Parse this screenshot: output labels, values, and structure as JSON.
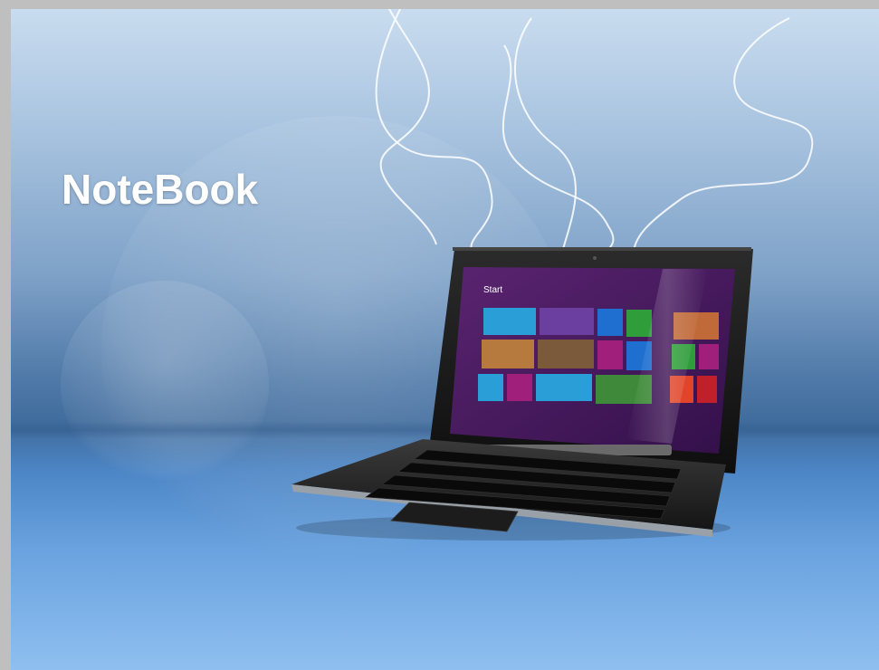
{
  "slide": {
    "title": "NoteBook"
  },
  "laptop": {
    "start_label": "Start",
    "tiles": [
      {
        "name": "mail-tile",
        "color": "#2a9ed6"
      },
      {
        "name": "calendar-tile",
        "color": "#6b3fa0"
      },
      {
        "name": "ie-tile",
        "color": "#1e6fd0"
      },
      {
        "name": "store-tile",
        "color": "#2f9d3a"
      },
      {
        "name": "people-tile",
        "color": "#b67a3e"
      },
      {
        "name": "photos-tile",
        "color": "#5a4a3a"
      },
      {
        "name": "music-tile",
        "color": "#a01f7a"
      },
      {
        "name": "skydrive-tile",
        "color": "#1e6fd0"
      },
      {
        "name": "weather-tile",
        "color": "#2a9ed6"
      },
      {
        "name": "messaging-tile",
        "color": "#a01f7a"
      },
      {
        "name": "sports-tile",
        "color": "#2f9d3a"
      },
      {
        "name": "xbox-games-tile",
        "color": "#2f9d3a"
      },
      {
        "name": "xbox-music-tile",
        "color": "#e0452b"
      },
      {
        "name": "travel-tile",
        "color": "#6a5a4a"
      }
    ]
  },
  "colors": {
    "screen_bg": "#4a1a5c",
    "title_color": "#ffffff"
  }
}
